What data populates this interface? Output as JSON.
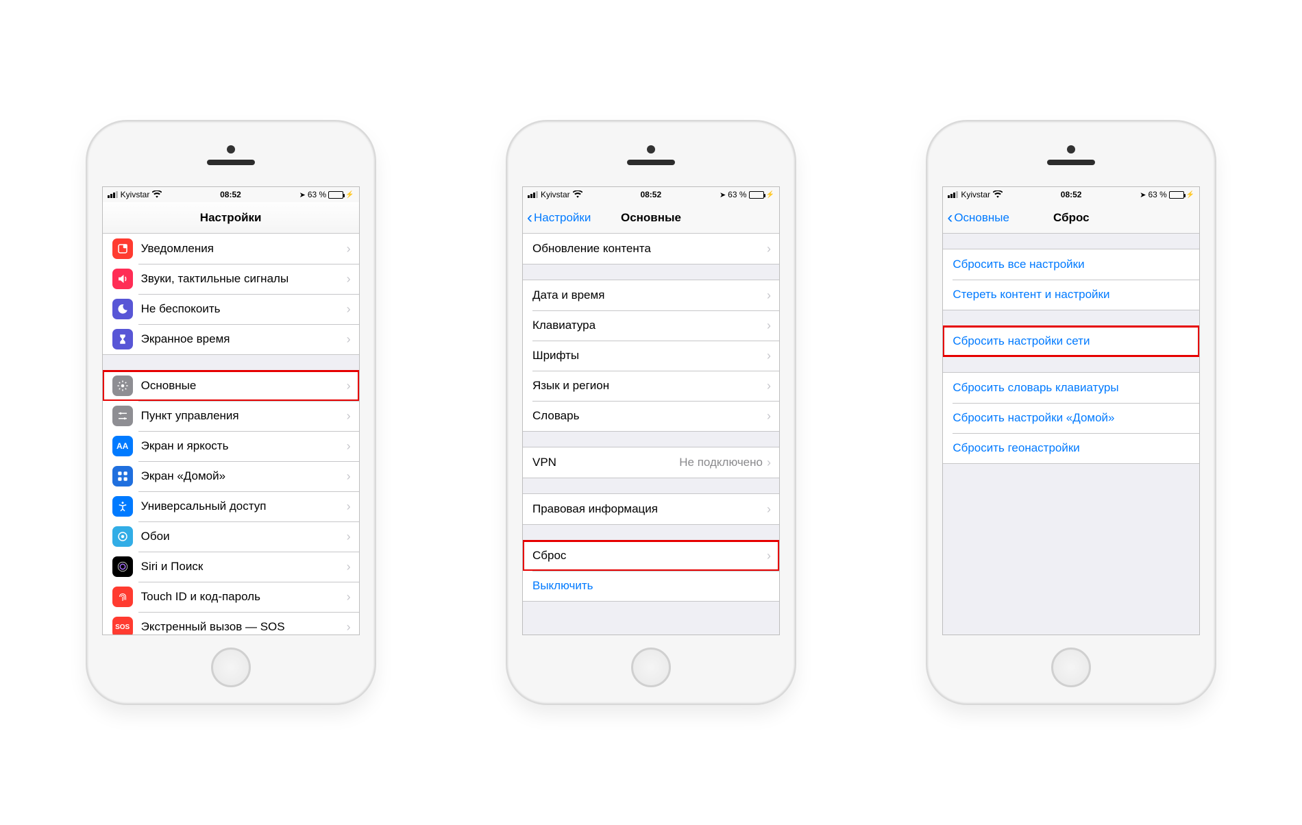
{
  "status": {
    "carrier": "Kyivstar",
    "time": "08:52",
    "battery_pct": "63 %"
  },
  "phone1": {
    "title": "Настройки",
    "rows": [
      {
        "label": "Уведомления",
        "icon": "notif"
      },
      {
        "label": "Звуки, тактильные сигналы",
        "icon": "sound"
      },
      {
        "label": "Не беспокоить",
        "icon": "dnd"
      },
      {
        "label": "Экранное время",
        "icon": "screentime"
      }
    ],
    "rows2": [
      {
        "label": "Основные",
        "icon": "general",
        "hl": true
      },
      {
        "label": "Пункт управления",
        "icon": "control"
      },
      {
        "label": "Экран и яркость",
        "icon": "display"
      },
      {
        "label": "Экран «Домой»",
        "icon": "home"
      },
      {
        "label": "Универсальный доступ",
        "icon": "access"
      },
      {
        "label": "Обои",
        "icon": "wallpaper"
      },
      {
        "label": "Siri и Поиск",
        "icon": "siri"
      },
      {
        "label": "Touch ID и код-пароль",
        "icon": "touchid"
      },
      {
        "label": "Экстренный вызов — SOS",
        "icon": "sos"
      }
    ]
  },
  "phone2": {
    "back": "Настройки",
    "title": "Основные",
    "g0": [
      {
        "label": "Обновление контента"
      }
    ],
    "g1": [
      {
        "label": "Дата и время"
      },
      {
        "label": "Клавиатура"
      },
      {
        "label": "Шрифты"
      },
      {
        "label": "Язык и регион"
      },
      {
        "label": "Словарь"
      }
    ],
    "g2": [
      {
        "label": "VPN",
        "value": "Не подключено"
      }
    ],
    "g3": [
      {
        "label": "Правовая информация"
      }
    ],
    "g4": [
      {
        "label": "Сброс",
        "hl": true
      },
      {
        "label": "Выключить",
        "blue": true,
        "nochev": true
      }
    ]
  },
  "phone3": {
    "back": "Основные",
    "title": "Сброс",
    "g1": [
      {
        "label": "Сбросить все настройки"
      },
      {
        "label": "Стереть контент и настройки"
      }
    ],
    "g2": [
      {
        "label": "Сбросить настройки сети",
        "hl": true
      }
    ],
    "g3": [
      {
        "label": "Сбросить словарь клавиатуры"
      },
      {
        "label": "Сбросить настройки «Домой»"
      },
      {
        "label": "Сбросить геонастройки"
      }
    ]
  }
}
